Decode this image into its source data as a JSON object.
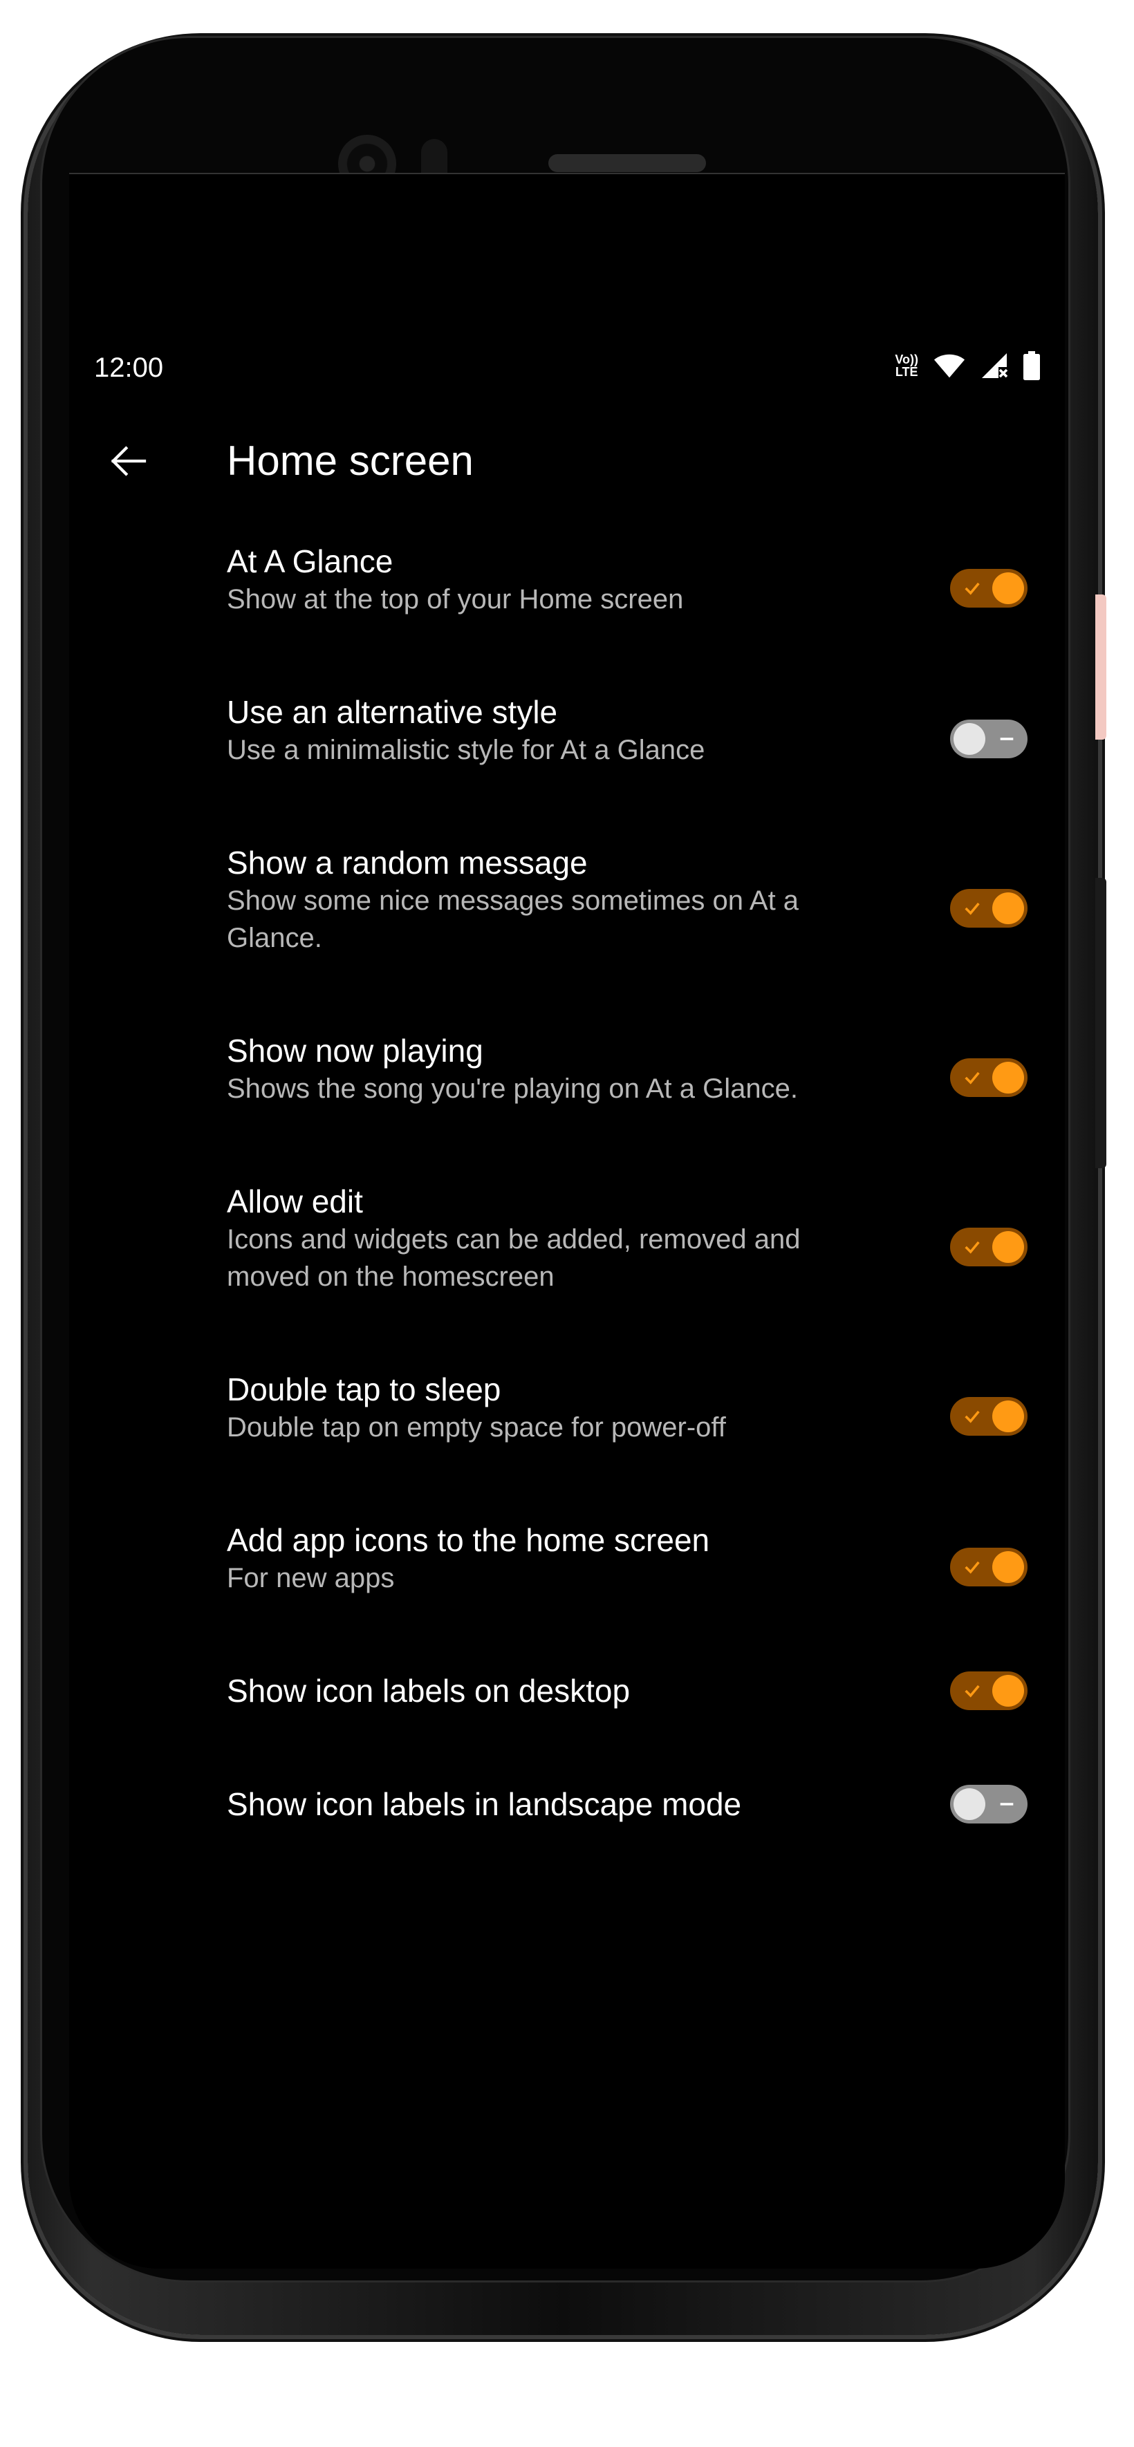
{
  "status_bar": {
    "time": "12:00",
    "volte_top": "Vo))",
    "volte_bottom": "LTE",
    "icons": [
      "volte-icon",
      "wifi-icon",
      "cell-signal-no-service-icon",
      "battery-icon"
    ]
  },
  "app_bar": {
    "back_icon": "arrow-back-icon",
    "title": "Home screen"
  },
  "theme": {
    "accent": "#ff9a14",
    "accent_track": "#8a4a00",
    "off_track": "#8f8f8f",
    "background": "#000000"
  },
  "settings": [
    {
      "title": "At A Glance",
      "summary": "Show at the top of your Home screen",
      "enabled": true
    },
    {
      "title": "Use an alternative style",
      "summary": "Use a minimalistic style for At a Glance",
      "enabled": false
    },
    {
      "title": "Show a random message",
      "summary": "Show some nice messages sometimes on At a Glance.",
      "enabled": true
    },
    {
      "title": "Show now playing",
      "summary": "Shows the song you're playing on At a Glance.",
      "enabled": true
    },
    {
      "title": "Allow edit",
      "summary": "Icons and widgets can be added, removed and moved on the homescreen",
      "enabled": true
    },
    {
      "title": "Double tap to sleep",
      "summary": "Double tap on empty space for power-off",
      "enabled": true
    },
    {
      "title": "Add app icons to the home screen",
      "summary": "For new apps",
      "enabled": true
    },
    {
      "title": "Show icon labels on desktop",
      "summary": "",
      "enabled": true
    },
    {
      "title": "Show icon labels in landscape mode",
      "summary": "",
      "enabled": false
    }
  ]
}
